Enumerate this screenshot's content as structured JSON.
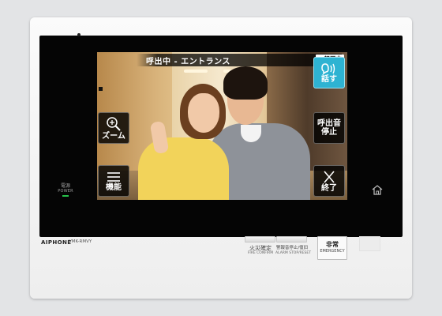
{
  "screen": {
    "status_title": "呼出中 - エントランス",
    "rec_badge": "録画中",
    "colors": {
      "accent": "#2eb3d2",
      "rec": "#e0001a",
      "overlay": "#000000"
    }
  },
  "buttons": {
    "talk": {
      "label": "話す",
      "icon": "talk-icon"
    },
    "zoom": {
      "label": "ズーム",
      "icon": "zoom-icon"
    },
    "stop_call": {
      "label_line1": "呼出音",
      "label_line2": "停止"
    },
    "function": {
      "label": "機能",
      "icon": "menu-icon"
    },
    "end": {
      "label": "終了",
      "icon": "close-icon"
    }
  },
  "panel": {
    "power_jp": "電源",
    "power_en": "POWER",
    "brand": "AIPHONE",
    "model": "VMK-RMVY",
    "fire_confirm_jp": "火災確定",
    "fire_confirm_en": "FIRE CONFIRM",
    "alarm_stop_jp": "警報音停止/復旧",
    "alarm_stop_en": "ALARM STOP/RESET",
    "emergency_jp": "非常",
    "emergency_en": "EMERGENCY",
    "home_icon": "home-icon"
  }
}
